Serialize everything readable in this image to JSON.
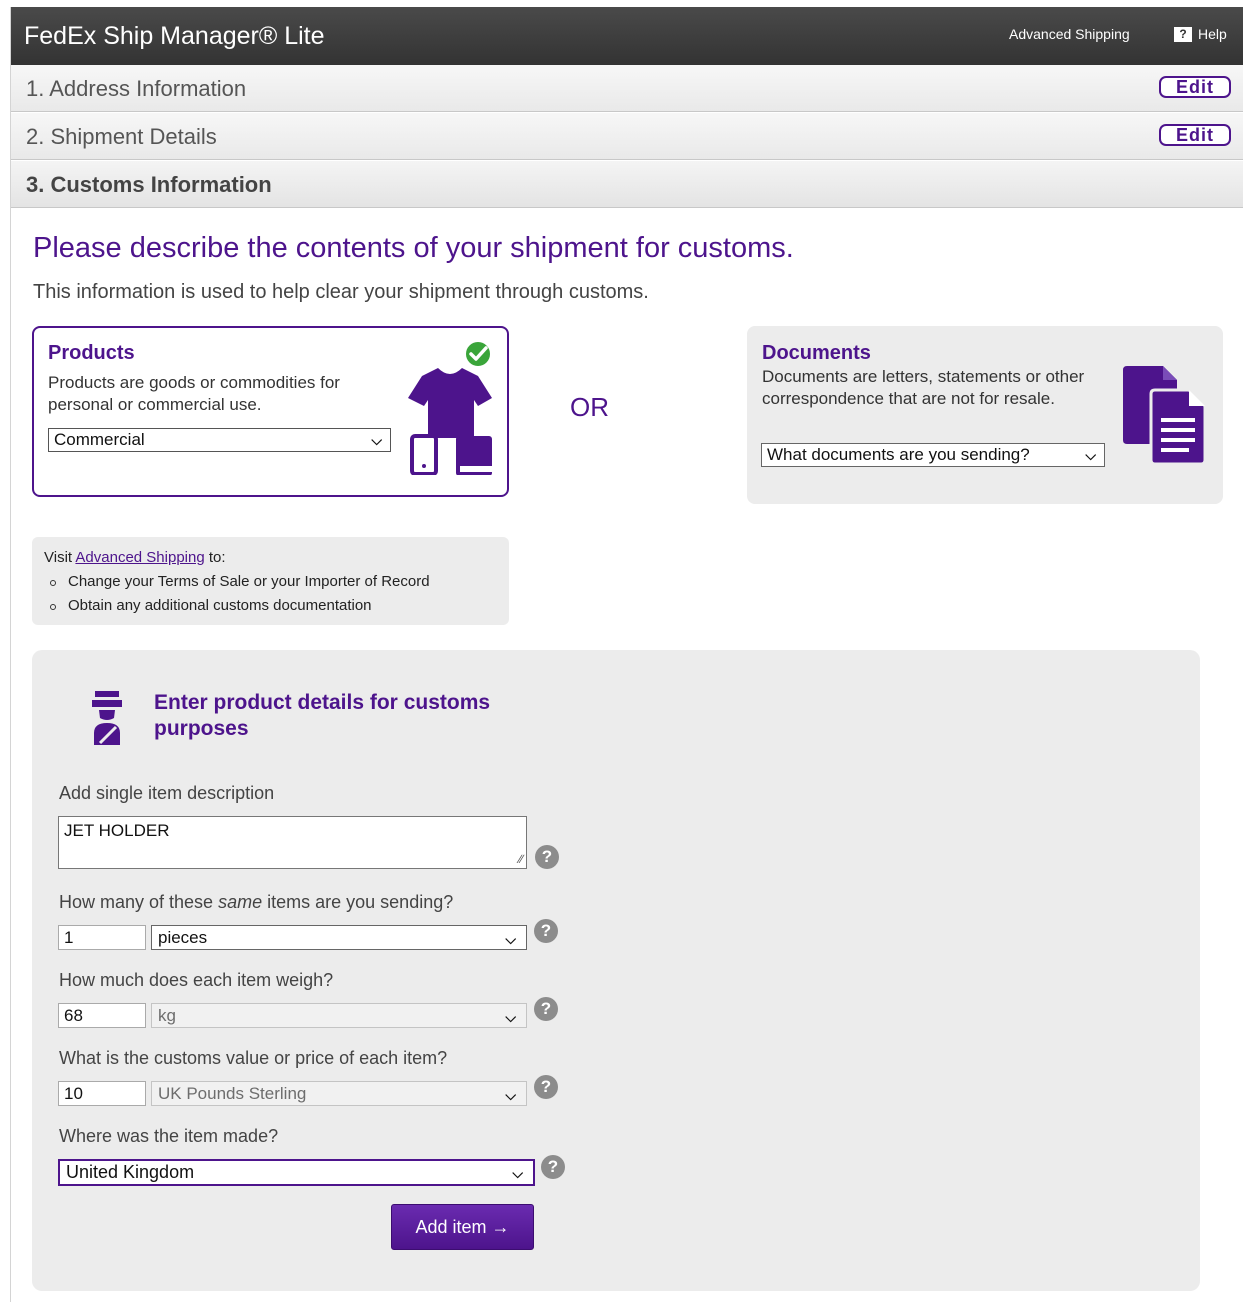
{
  "header": {
    "app_title": "FedEx Ship Manager® Lite",
    "advanced_shipping": "Advanced Shipping",
    "help": "Help",
    "help_icon_glyph": "?"
  },
  "steps": [
    {
      "label": "1.  Address Information",
      "edit": "Edit"
    },
    {
      "label": "2.  Shipment Details",
      "edit": "Edit"
    },
    {
      "label": "3.  Customs Information"
    }
  ],
  "intro": {
    "heading": "Please describe the contents of your shipment for customs.",
    "subheading": "This information is used to help clear your shipment through customs."
  },
  "products": {
    "title": "Products",
    "description": "Products are goods or commodities for personal or commercial use.",
    "selected": "Commercial"
  },
  "or_label": "OR",
  "documents": {
    "title": "Documents",
    "description": "Documents are letters, statements or other correspondence that are not for resale.",
    "selected": "What documents are you sending?"
  },
  "advanced_note": {
    "visit": "Visit",
    "link": "Advanced Shipping",
    "to": "to:",
    "items": [
      "Change your Terms of Sale or your Importer of Record",
      "Obtain any additional customs documentation"
    ]
  },
  "details": {
    "title": "Enter product details for customs purposes",
    "description_label": "Add single item description",
    "description_value": "JET HOLDER",
    "quantity_label_pre": "How many of these",
    "quantity_label_em": "same",
    "quantity_label_post": "items are you sending?",
    "quantity_value": "1",
    "quantity_unit": "pieces",
    "weight_label": "How much does each item weigh?",
    "weight_value": "68",
    "weight_unit": "kg",
    "value_label": "What is the customs value or price of each item?",
    "value_value": "10",
    "value_currency": "UK Pounds Sterling",
    "origin_label": "Where was the item made?",
    "origin_value": "United Kingdom",
    "add_button": "Add item →",
    "help_glyph": "?"
  },
  "colors": {
    "fedex_purple": "#4d148c",
    "header_dark": "#333333",
    "check_green": "#3aa53a",
    "panel_gray": "#ececec"
  }
}
